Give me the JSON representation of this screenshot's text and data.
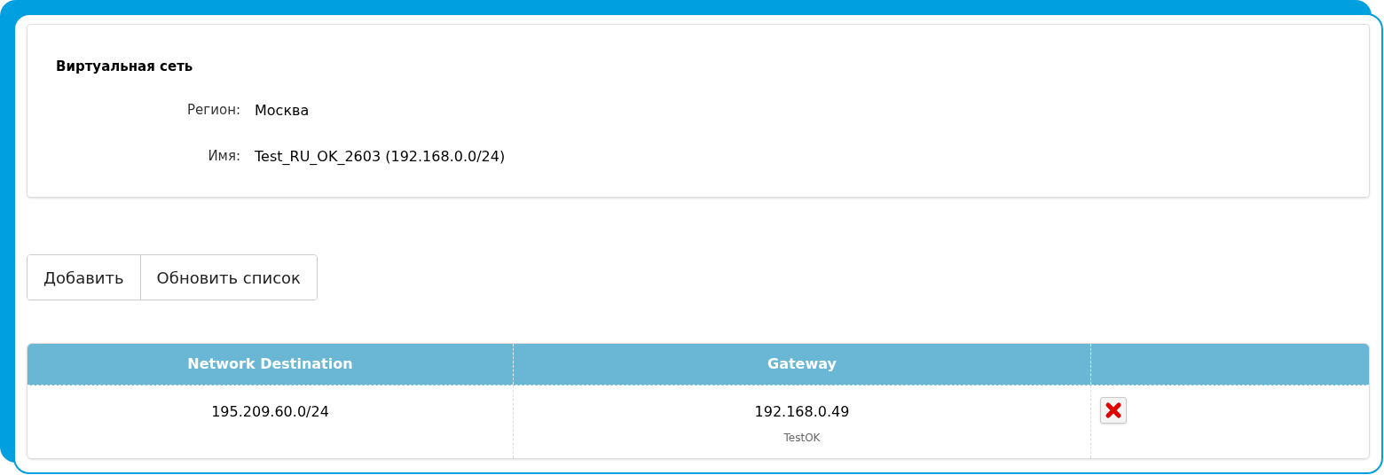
{
  "info": {
    "title": "Виртуальная сеть",
    "fields": [
      {
        "label": "Регион:",
        "value": "Москва"
      },
      {
        "label": "Имя:",
        "value": "Test_RU_OK_2603 (192.168.0.0/24)"
      }
    ]
  },
  "buttons": [
    "Добавить",
    "Обновить список"
  ],
  "table": {
    "columns": [
      "Network Destination",
      "Gateway"
    ],
    "rows": [
      {
        "destination": "195.209.60.0/24",
        "gateway": "192.168.0.49",
        "gateway_note": "TestOK"
      }
    ]
  }
}
